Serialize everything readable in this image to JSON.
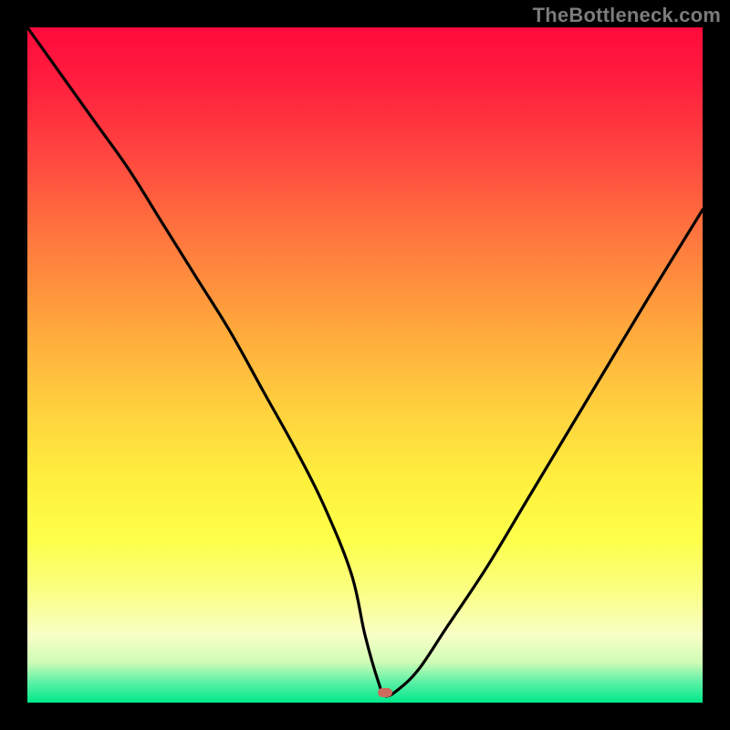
{
  "watermark": "TheBottleneck.com",
  "colors": {
    "gradient_top": "#ff0a3c",
    "gradient_mid": "#ffe93c",
    "gradient_bottom": "#00e88a",
    "curve": "#000000",
    "marker": "#cf6a5e",
    "frame": "#000000"
  },
  "chart_data": {
    "type": "line",
    "title": "",
    "xlabel": "",
    "ylabel": "",
    "xlim": [
      0,
      100
    ],
    "ylim": [
      0,
      100
    ],
    "grid": false,
    "legend": false,
    "marker": {
      "x": 53,
      "y": 1.5,
      "shape": "rounded-rect"
    },
    "series": [
      {
        "name": "bottleneck-curve",
        "x": [
          0,
          5,
          10,
          15,
          20,
          25,
          30,
          35,
          40,
          44,
          48,
          50,
          52,
          53,
          55,
          58,
          62,
          68,
          74,
          80,
          86,
          92,
          100
        ],
        "y": [
          100,
          93,
          86,
          79,
          71,
          63,
          55,
          46,
          37,
          29,
          19,
          10,
          3,
          1,
          2,
          5,
          11,
          20,
          30,
          40,
          50,
          60,
          73
        ]
      }
    ]
  }
}
